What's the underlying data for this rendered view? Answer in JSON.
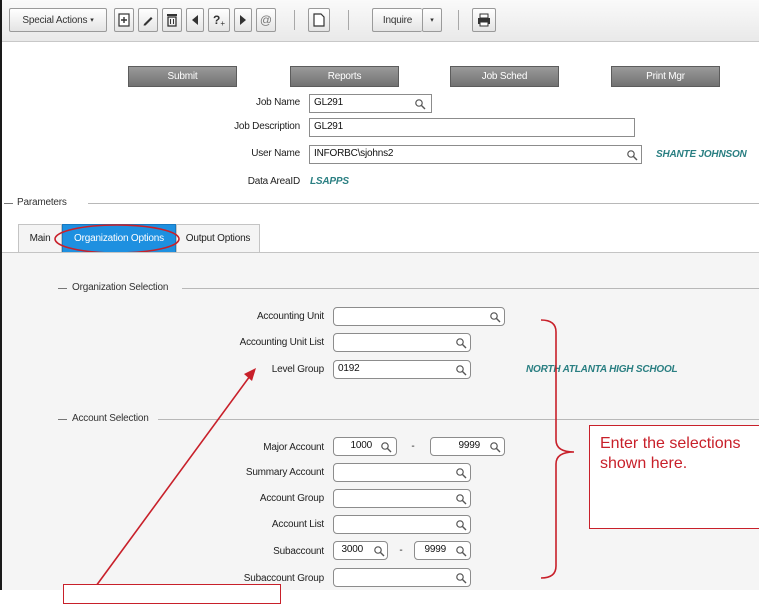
{
  "toolbar": {
    "special_actions_label": "Special Actions",
    "inquire_label": "Inquire",
    "icons": [
      "add-icon",
      "pencil-icon",
      "trash-icon",
      "prev-icon",
      "help-icon",
      "next-icon",
      "at-icon",
      "copy-icon",
      "dropdown-icon",
      "print-icon"
    ]
  },
  "actions": {
    "submit": "Submit",
    "reports": "Reports",
    "job_sched": "Job Sched",
    "print_mgr": "Print Mgr"
  },
  "job": {
    "job_name_label": "Job Name",
    "job_name_value": "GL291",
    "job_desc_label": "Job Description",
    "job_desc_value": "GL291",
    "user_name_label": "User Name",
    "user_name_value": "INFORBC\\sjohns2",
    "user_full_name": "SHANTE JOHNSON",
    "data_area_label": "Data AreaID",
    "data_area_value": "LSAPPS"
  },
  "parameters_title": "Parameters",
  "tabs": {
    "main": "Main",
    "organization_options": "Organization Options",
    "output_options": "Output Options"
  },
  "org_selection": {
    "title": "Organization Selection",
    "accounting_unit_label": "Accounting Unit",
    "accounting_unit_value": "",
    "accounting_unit_list_label": "Accounting Unit List",
    "accounting_unit_list_value": "",
    "level_group_label": "Level Group",
    "level_group_value": "0192",
    "level_group_desc": "NORTH ATLANTA HIGH SCHOOL"
  },
  "account_selection": {
    "title": "Account Selection",
    "major_account_label": "Major Account",
    "major_account_from": "1000",
    "major_account_to": "9999",
    "summary_account_label": "Summary Account",
    "account_group_label": "Account Group",
    "account_list_label": "Account List",
    "subaccount_label": "Subaccount",
    "subaccount_from": "3000",
    "subaccount_to": "9999",
    "subaccount_group_label": "Subaccount Group",
    "range_separator": "-"
  },
  "annotations": {
    "callout_text": "Enter the selections shown here.",
    "accent_color": "#c8202a"
  },
  "colors": {
    "tab_active": "#1e90e0",
    "teal_text": "#2a7f82",
    "button_gray": "#858585"
  }
}
